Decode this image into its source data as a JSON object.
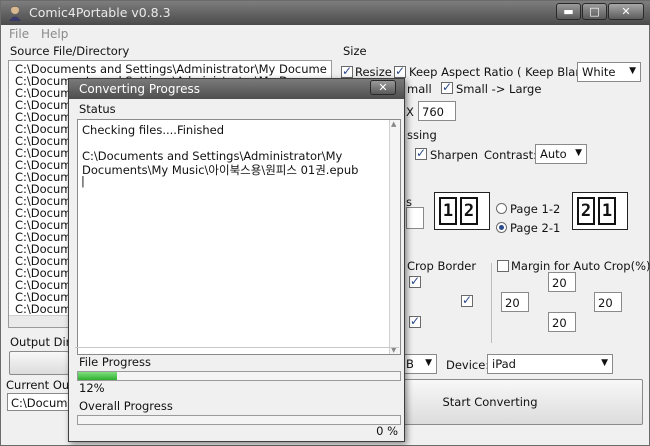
{
  "window": {
    "title": "Comic4Portable v0.8.3",
    "minimize": "▬",
    "maximize": "□",
    "close": "✕"
  },
  "menu": [
    "File",
    "Help"
  ],
  "source": {
    "label": "Source File/Directory",
    "rows": [
      "C:\\Documents and Settings\\Administrator\\My Docume",
      "C:\\Documents and Settings\\Administrator\\My Docu",
      "C:\\Docum",
      "C:\\Docum",
      "C:\\Docum",
      "C:\\Docum",
      "C:\\Docum",
      "C:\\Docum",
      "C:\\Docum",
      "C:\\Docum",
      "C:\\Docum",
      "C:\\Docum",
      "C:\\Docum",
      "C:\\Docum",
      "C:\\Docum",
      "C:\\Docum",
      "C:\\Docum",
      "C:\\Docum",
      "C:\\Docum",
      "C:\\Docum",
      "C:\\Docum",
      "C:\\Docum"
    ]
  },
  "output": {
    "dir_label": "Output Dire",
    "current_label": "Current Outp",
    "current_value": "C:\\Docume"
  },
  "size": {
    "label": "Size",
    "resize": "Resize",
    "keep_aspect": "Keep Aspect Ratio ( Keep Blank:",
    "blank_value": "White",
    "small_partial": "mall",
    "small_large": "Small -> Large",
    "x_label": "X",
    "height": "760"
  },
  "processing": {
    "label_partial": "ssing",
    "sharpen": "Sharpen",
    "contrast_label": "Contrast:",
    "contrast_value": "Auto"
  },
  "page": {
    "left_icon": [
      "1",
      "2"
    ],
    "right_icon": [
      "2",
      "1"
    ],
    "opt1": "Page 1-2",
    "opt2": "Page 2-1",
    "partial": "s"
  },
  "crop": {
    "border_label": "Crop Border",
    "margin_label": "Margin for Auto Crop(%)",
    "top": "20",
    "left": "20",
    "right": "20",
    "bottom": "20"
  },
  "device": {
    "partial": "B",
    "label": "Device:",
    "value": "iPad"
  },
  "start_button": "Start Converting",
  "dialog": {
    "title": "Converting Progress",
    "close": "✕",
    "status_label": "Status",
    "status_lines": [
      "Checking files....Finished",
      "",
      "C:\\Documents and Settings\\Administrator\\My",
      "Documents\\My Music\\아이북스용\\원피스 01권.epub",
      "|"
    ],
    "file_progress_label": "File Progress",
    "file_progress_value": 12,
    "file_progress_text": "12%",
    "overall_progress_label": "Overall Progress",
    "overall_progress_value": 0,
    "overall_progress_text": "0 %"
  }
}
